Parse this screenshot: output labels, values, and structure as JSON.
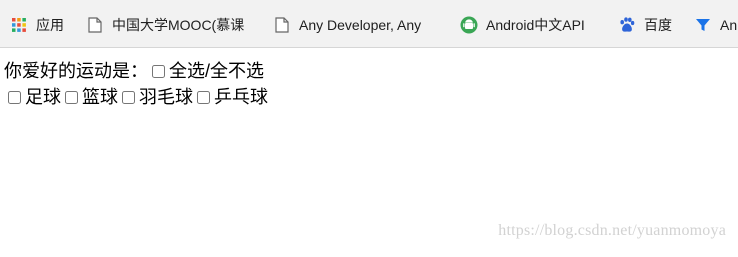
{
  "bookmarks": {
    "apps": {
      "label": "应用",
      "icon": "apps-grid-icon"
    },
    "items": [
      {
        "label": "中国大学MOOC(慕课",
        "icon": "page-icon"
      },
      {
        "label": "Any Developer, Any",
        "icon": "page-icon"
      },
      {
        "label": "Android中文API",
        "icon": "android-icon"
      },
      {
        "label": "百度",
        "icon": "baidu-paw-icon"
      },
      {
        "label": "An",
        "icon": "filter-icon"
      }
    ]
  },
  "form": {
    "prompt": "你爱好的运动是：",
    "select_all_label": "全选/全不选",
    "options": [
      {
        "label": "足球",
        "checked": false
      },
      {
        "label": "篮球",
        "checked": false
      },
      {
        "label": "羽毛球",
        "checked": false
      },
      {
        "label": "乒乓球",
        "checked": false
      }
    ]
  },
  "watermark": "https://blog.csdn.net/yuanmomoya"
}
